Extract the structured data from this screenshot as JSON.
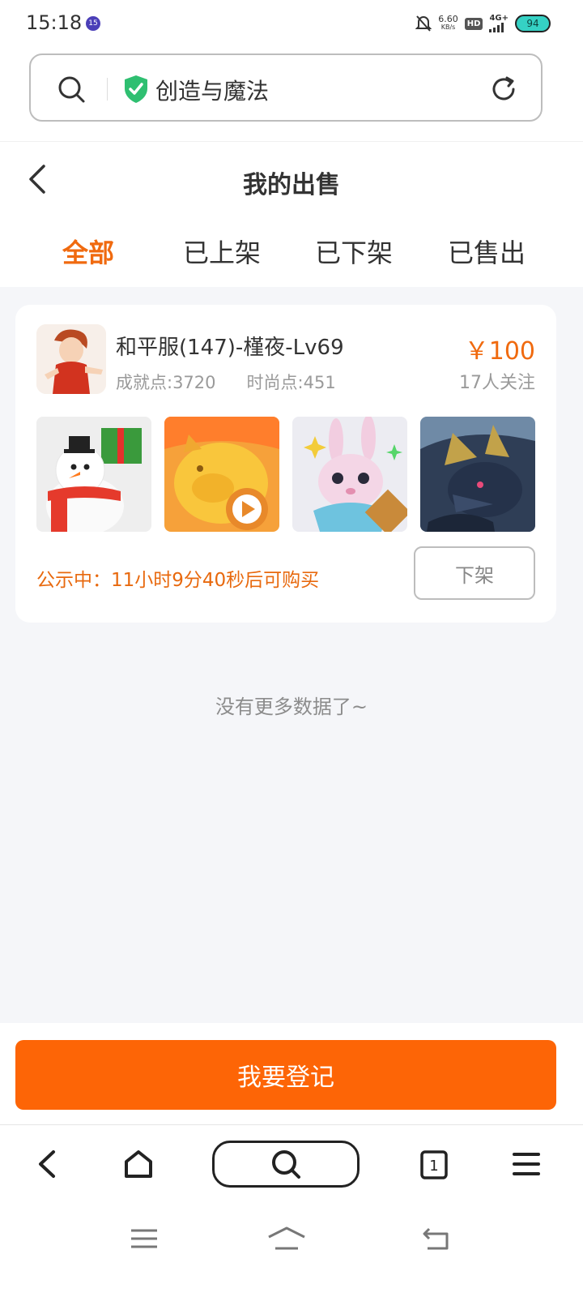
{
  "status_bar": {
    "time": "15:18",
    "app_badge": "15",
    "net_speed_value": "6.60",
    "net_speed_unit": "KB/s",
    "hd": "HD",
    "network": "4G+",
    "battery": "94"
  },
  "address_bar": {
    "text": "创造与魔法"
  },
  "header": {
    "title": "我的出售",
    "tabs": [
      {
        "label": "全部",
        "active": true
      },
      {
        "label": "已上架",
        "active": false
      },
      {
        "label": "已下架",
        "active": false
      },
      {
        "label": "已售出",
        "active": false
      }
    ]
  },
  "listing": {
    "title": "和平服(147)-槿夜-Lv69",
    "achievement": "成就点:3720",
    "fashion": "时尚点:451",
    "price": "￥100",
    "followers": "17人关注",
    "notice": "公示中：11小时9分40秒后可购买",
    "delist_label": "下架"
  },
  "no_more": "没有更多数据了~",
  "register_label": "我要登记",
  "browser_nav": {
    "tab_count": "1"
  },
  "colors": {
    "accent": "#f06a0f",
    "button": "#fd6506",
    "background": "#f5f6f9"
  }
}
